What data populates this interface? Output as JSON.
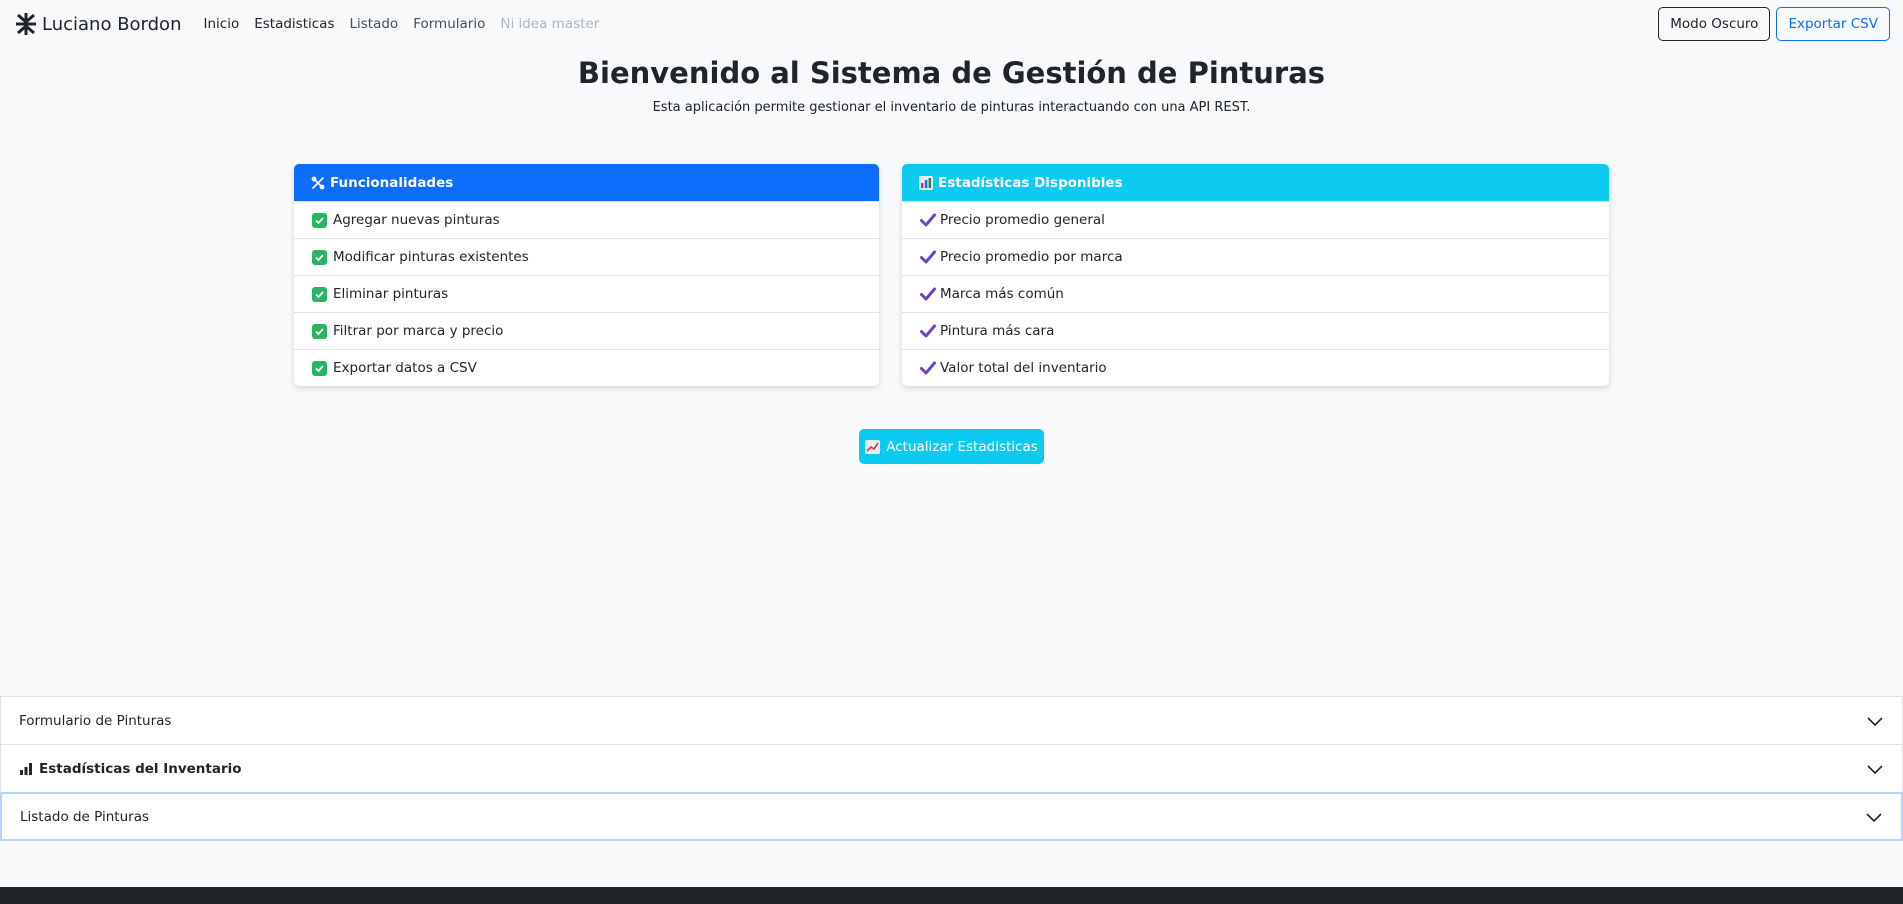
{
  "navbar": {
    "brand": "Luciano Bordon",
    "links": [
      "Inicio",
      "Estadisticas",
      "Listado",
      "Formulario",
      "Ni idea master"
    ],
    "dark_mode_button": "Modo Oscuro",
    "export_button": "Exportar CSV"
  },
  "hero": {
    "title": "Bienvenido al Sistema de Gestión de Pinturas",
    "subtitle": "Esta aplicación permite gestionar el inventario de pinturas interactuando con una API REST."
  },
  "features_card": {
    "title": "Funcionalidades",
    "icon": "tools-icon",
    "items": [
      "Agregar nuevas pinturas",
      "Modificar pinturas existentes",
      "Eliminar pinturas",
      "Filtrar por marca y precio",
      "Exportar datos a CSV"
    ]
  },
  "stats_card": {
    "title": "Estadísticas Disponibles",
    "icon": "bar-chart-icon",
    "items": [
      "Precio promedio general",
      "Precio promedio por marca",
      "Marca más común",
      "Pintura más cara",
      "Valor total del inventario"
    ]
  },
  "update_button": {
    "label": "Actualizar Estadisticas",
    "icon": "chart-up-icon"
  },
  "accordion": {
    "items": [
      "Formulario de Pinturas",
      "Estadísticas del Inventario",
      "Listado de Pinturas"
    ]
  },
  "colors": {
    "primary": "#0d6efd",
    "info": "#0dcaf0",
    "check": "#28b463",
    "tick": "#6f42c1"
  }
}
